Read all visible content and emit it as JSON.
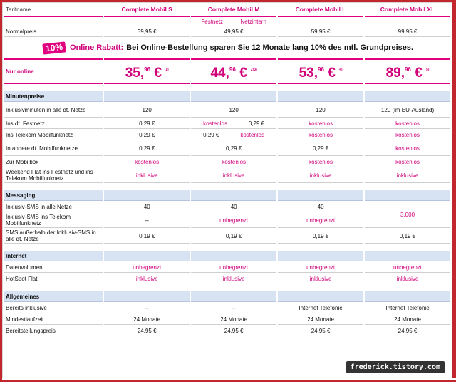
{
  "header": {
    "label": "Tarifname",
    "plans": [
      "Complete Mobil S",
      "Complete Mobil M",
      "Complete Mobil L",
      "Complete Mobil XL"
    ],
    "m_sub_left": "Festnetz",
    "m_sub_right": "Netzintern"
  },
  "normalpreis": {
    "label": "Normalpreis",
    "values": [
      "39,95 €",
      "49,95 €",
      "59,95 €",
      "99,95 €"
    ]
  },
  "promo": {
    "badge": "10%",
    "lead": "Online Rabatt:",
    "text": "Bei Online-Bestellung sparen Sie 12 Monate lang 10% des mtl. Grundpreises."
  },
  "online": {
    "label": "Nur online",
    "prices": [
      {
        "main": "35,",
        "cents": "96",
        "cur": "€",
        "fn": "1)"
      },
      {
        "main": "44,",
        "cents": "96",
        "cur": "€",
        "fn": "2)3)"
      },
      {
        "main": "53,",
        "cents": "96",
        "cur": "€",
        "fn": "4)"
      },
      {
        "main": "89,",
        "cents": "96",
        "cur": "€",
        "fn": "5)"
      }
    ]
  },
  "minuten": {
    "title": "Minutenpreise",
    "rows": [
      {
        "label": "Inklusivminuten in alle dt. Netze",
        "s": "120",
        "m": "120",
        "l": "120",
        "xl": "120 (im EU-Ausland)"
      },
      {
        "label": "Ins dt. Festnetz",
        "s": "0,29 €",
        "m_a": "kostenlos",
        "m_b": "0,29 €",
        "l": "kostenlos",
        "xl": "kostenlos"
      },
      {
        "label": "Ins Telekom Mobilfunknetz",
        "s": "0,29 €",
        "m_a": "0,29 €",
        "m_b": "kostenlos",
        "l": "kostenlos",
        "xl": "kostenlos"
      },
      {
        "label": "In andere dt. Mobilfunknetze",
        "s": "0,29 €",
        "m": "0,29 €",
        "l": "0,29 €",
        "xl": "kostenlos"
      },
      {
        "label": "Zur Mobilbox",
        "s": "kostenlos",
        "m": "kostenlos",
        "l": "kostenlos",
        "xl": "kostenlos"
      },
      {
        "label": "Weekend Flat ins Festnetz und ins Telekom Mobilfunknetz",
        "s": "inklusive",
        "m": "inklusive",
        "l": "inklusive",
        "xl": "inklusive"
      }
    ]
  },
  "messaging": {
    "title": "Messaging",
    "rows": [
      {
        "label": "Inklusiv-SMS in alle Netze",
        "s": "40",
        "m": "40",
        "l": "40"
      },
      {
        "label": "Inklusiv-SMS ins Telekom Mobilfunknetz",
        "s": "--",
        "m": "unbegrenzt",
        "l": "unbegrenzt"
      },
      {
        "label": "SMS außerhalb der Inklusiv-SMS in alle dt. Netze",
        "s": "0,19 €",
        "m": "0,19 €",
        "l": "0,19 €",
        "xl": "0,19 €"
      }
    ],
    "xl_merged": "3.000"
  },
  "internet": {
    "title": "Internet",
    "rows": [
      {
        "label": "Datenvolumen",
        "s": "unbegrenzt",
        "m": "unbegrenzt",
        "l": "unbegrenzt",
        "xl": "unbegrenzt"
      },
      {
        "label": "HotSpot Flat",
        "s": "inklusive",
        "m": "inklusive",
        "l": "inklusive",
        "xl": "inklusive"
      }
    ]
  },
  "allgemeines": {
    "title": "Allgemeines",
    "rows": [
      {
        "label": "Bereits inklusive",
        "s": "--",
        "m": "--",
        "l": "Internet Telefonie",
        "xl": "Internet Telefonie"
      },
      {
        "label": "Mindestlaufzeit",
        "s": "24 Monate",
        "m": "24 Monate",
        "l": "24 Monate",
        "xl": "24 Monate"
      },
      {
        "label": "Bereitstellungspreis",
        "s": "24,95 €",
        "m": "24,95 €",
        "l": "24,95 €",
        "xl": "24,95 €"
      }
    ]
  },
  "watermark": "frederick.tistory.com",
  "colors": {
    "accent": "#e0007f",
    "section_bg": "#d7e2f2",
    "frame": "#c3272e"
  }
}
